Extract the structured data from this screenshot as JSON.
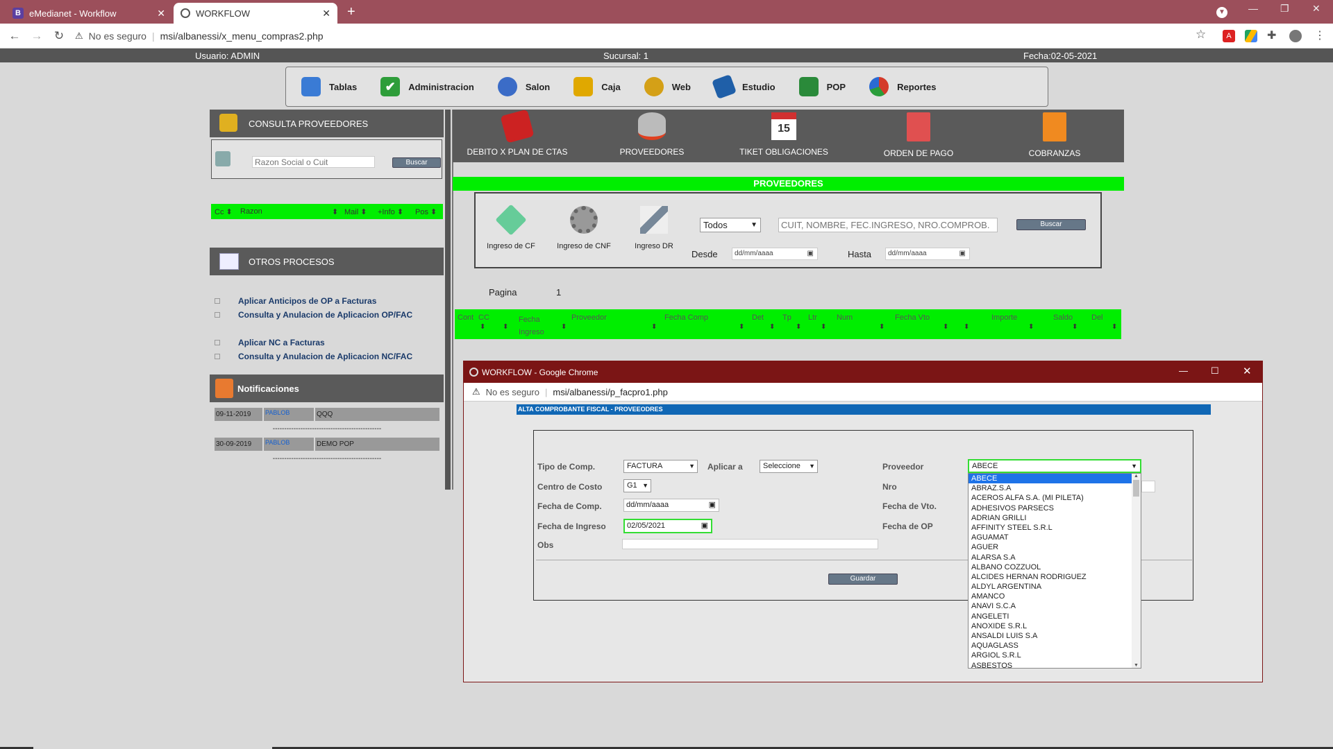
{
  "browser": {
    "tabs": [
      {
        "label": "eMedianet - Workflow",
        "favicon": "B"
      },
      {
        "label": "WORKFLOW"
      }
    ],
    "security": "No es seguro",
    "url": "msi/albanessi/x_menu_compras2.php"
  },
  "infobar": {
    "user": "Usuario: ADMIN",
    "branch": "Sucursal: 1",
    "date": "Fecha:02-05-2021"
  },
  "menu": [
    {
      "label": "Tablas",
      "icon": "tables-icon",
      "color": "#3a7bd5"
    },
    {
      "label": "Administracion",
      "icon": "check-icon",
      "color": "#2e9d3a"
    },
    {
      "label": "Salon",
      "icon": "globe-icon",
      "color": "#3b6cc7"
    },
    {
      "label": "Caja",
      "icon": "cash-icon",
      "color": "#e0a800"
    },
    {
      "label": "Web",
      "icon": "search-globe-icon",
      "color": "#d4a017"
    },
    {
      "label": "Estudio",
      "icon": "book-icon",
      "color": "#1f5fa8"
    },
    {
      "label": "POP",
      "icon": "people-icon",
      "color": "#2a8a3a"
    },
    {
      "label": "Reportes",
      "icon": "pie-chart-icon",
      "color": "#d43a2a"
    }
  ],
  "sidebar": {
    "consulta_title": "CONSULTA PROVEEDORES",
    "search_placeholder": "Razon Social o Cuit",
    "search_button": "Buscar",
    "columns": [
      "Cc",
      "Razon",
      "Mail",
      "+Info",
      "Pos"
    ],
    "otros_title": "OTROS PROCESOS",
    "links": [
      "Aplicar Anticipos de OP a Facturas",
      "Consulta y Anulacion de Aplicacion OP/FAC",
      "Aplicar NC a Facturas",
      "Consulta y Anulacion de Aplicacion NC/FAC"
    ],
    "notif_title": "Notificaciones",
    "notifications": [
      {
        "date": "09-11-2019",
        "user": "PABLOB",
        "text": "QQQ"
      },
      {
        "date": "30-09-2019",
        "user": "PABLOB",
        "text": "DEMO POP"
      }
    ],
    "separator": "-----------------------------------------------"
  },
  "main": {
    "icons": [
      {
        "label": "DEBITO X PLAN DE CTAS",
        "icon": "ledger-icon",
        "color": "#cc2222"
      },
      {
        "label": "PROVEEDORES",
        "icon": "database-icon",
        "color": "#999999"
      },
      {
        "label": "TIKET OBLIGACIONES",
        "icon": "calendar-icon",
        "color": "#d03030"
      },
      {
        "label": "ORDEN DE PAGO",
        "icon": "document-red-icon",
        "color": "#e05050"
      },
      {
        "label": "COBRANZAS",
        "icon": "document-orange-icon",
        "color": "#f08a20"
      }
    ],
    "section_title": "PROVEEDORES",
    "tools": [
      {
        "label": "Ingreso de CF",
        "icon": "tools-icon"
      },
      {
        "label": "Ingreso de CNF",
        "icon": "gear-icon"
      },
      {
        "label": "Ingreso DR",
        "icon": "pen-icon"
      }
    ],
    "filter_select": "Todos",
    "filter_placeholder": "CUIT, NOMBRE, FEC.INGRESO, NRO.COMPROB.",
    "filter_button": "Buscar",
    "desde_label": "Desde",
    "hasta_label": "Hasta",
    "date_placeholder": "dd/mm/aaaa",
    "pagina_label": "Pagina",
    "pagina_value": "1",
    "columns": [
      "Cont",
      "CC",
      "Fecha Ingreso",
      "Proveedor",
      "Fecha Comp",
      "Det",
      "Tp",
      "Ltr",
      "Num",
      "Fecha Vto",
      "Importe",
      "Saldo",
      "Del"
    ]
  },
  "popup": {
    "window_title": "WORKFLOW - Google Chrome",
    "security": "No es seguro",
    "url": "msi/albanessi/p_facpro1.php",
    "header": "ALTA COMPROBANTE FISCAL - PROVEEODRES",
    "tipo_label": "Tipo de Comp.",
    "tipo_value": "FACTURA",
    "aplicar_label": "Aplicar a",
    "aplicar_value": "Seleccione",
    "proveedor_label": "Proveedor",
    "proveedor_value": "ABECE",
    "centro_label": "Centro de Costo",
    "centro_value": "G1",
    "nro_label": "Nro",
    "fecha_comp_label": "Fecha de Comp.",
    "fecha_comp_value": "dd/mm/aaaa",
    "fecha_vto_label": "Fecha de Vto.",
    "fecha_ingreso_label": "Fecha de Ingreso",
    "fecha_ingreso_value": "02/05/2021",
    "fecha_op_label": "Fecha de OP",
    "obs_label": "Obs",
    "guardar": "Guardar",
    "options": [
      "ABECE",
      "ABRAZ.S.A",
      "ACEROS ALFA S.A. (MI PILETA)",
      "ADHESIVOS PARSECS",
      "ADRIAN GRILLI",
      "AFFINITY STEEL S.R.L",
      "AGUAMAT",
      "AGUER",
      "ALARSA S.A",
      "ALBANO COZZUOL",
      "ALCIDES HERNAN RODRIGUEZ",
      "ALDYL ARGENTINA",
      "AMANCO",
      "ANAVI S.C.A",
      "ANGELETI",
      "ANOXIDE S.R.L",
      "ANSALDI LUIS S.A",
      "AQUAGLASS",
      "ARGIOL S.R.L",
      "ASBESTOS"
    ]
  }
}
